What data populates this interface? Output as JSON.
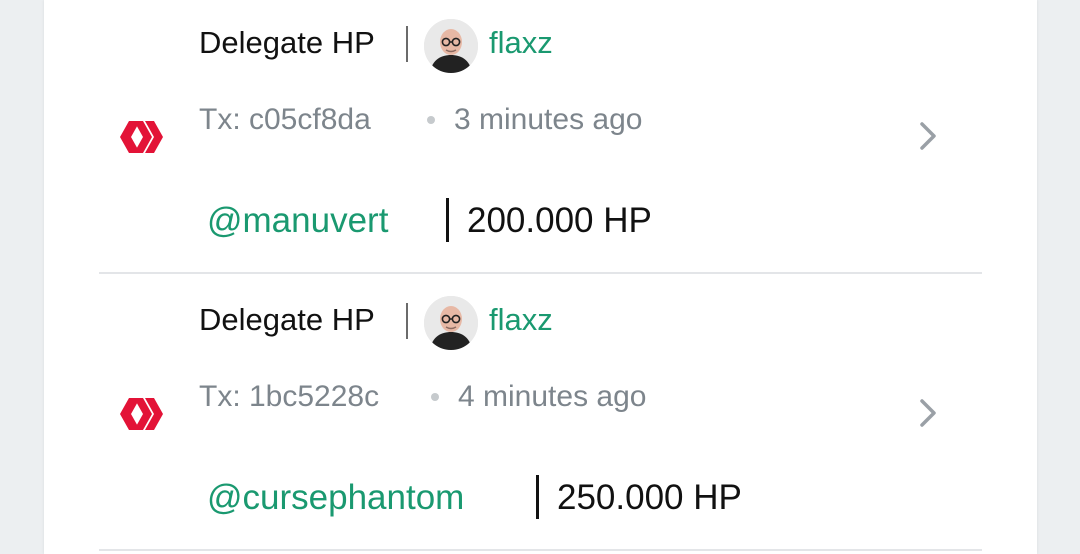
{
  "transactions": [
    {
      "operation": "Delegate HP",
      "author": "flaxz",
      "tx_id": "Tx: c05cf8da",
      "time_ago": "3 minutes ago",
      "delegatee": "@manuvert",
      "amount": "200.000 HP"
    },
    {
      "operation": "Delegate HP",
      "author": "flaxz",
      "tx_id": "Tx: 1bc5228c",
      "time_ago": "4 minutes ago",
      "delegatee": "@cursephantom",
      "amount": "250.000 HP"
    }
  ],
  "icons": {
    "chain_logo": "hive-logo-icon",
    "author_avatar": "user-avatar",
    "details": "chevron-right-icon"
  },
  "colors": {
    "accent_green": "#1a9970",
    "hive_red": "#e31337",
    "muted_text": "#7d858c"
  }
}
